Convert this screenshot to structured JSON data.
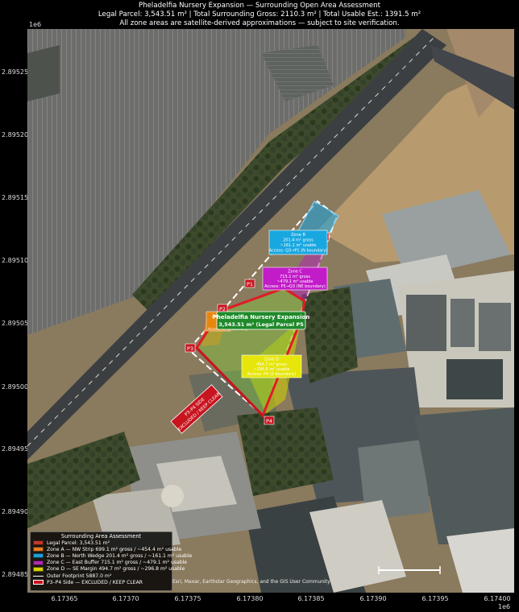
{
  "header": {
    "title": "Pheladelfia Nursery Expansion — Surrounding Open Area Assessment",
    "summary": "Legal Parcel: 3,543.51 m²  |  Total Surrounding Gross: 2110.3 m²  |  Total Usable Est.: 1391.5 m²",
    "note": "All zone areas are satellite-derived approximations — subject to site verification."
  },
  "axes": {
    "y_exponent": "1e6",
    "x_exponent": "1e6",
    "y_ticks": [
      "2.89525",
      "2.89520",
      "2.89515",
      "2.89510",
      "2.89505",
      "2.89500",
      "2.89495",
      "2.89490",
      "2.89485"
    ],
    "x_ticks": [
      "6.17365",
      "6.17370",
      "6.17375",
      "6.17380",
      "6.17385",
      "6.17390",
      "6.17395",
      "6.17400"
    ]
  },
  "points": {
    "p1": "P1",
    "p2": "P2",
    "p3": "P3",
    "p4": "P4",
    "q3": "Q3"
  },
  "zones": {
    "parcel": {
      "line1": "Pheladelfia Nursery Expansion",
      "line2": "3,543.51 m² (Legal Parcel P5"
    },
    "zone_a": {
      "line1": "Zone A",
      "line2": "Access: P2 (W boundary)"
    },
    "zone_b": {
      "line1": "Zone B",
      "line2": "201.4 m² gross",
      "line3": "~161.1 m² usable",
      "line4": "Access: Q3→P1 (N boundary)"
    },
    "zone_c": {
      "line1": "Zone C",
      "line2": "715.1 m² gross",
      "line3": "~479.1 m² usable",
      "line4": "Access: P5→Q3 (NE boundary)"
    },
    "zone_d": {
      "line1": "Zone D",
      "line2": "494.7 m² gross",
      "line3": "~296.8 m² usable",
      "line4": "Access: P4 (S boundary)"
    },
    "excluded": {
      "line1": "P3–P4 SIDE",
      "line2": "EXCLUDED / KEEP CLEAR"
    }
  },
  "legend": {
    "title": "Surrounding Area Assessment",
    "items": [
      {
        "label": "Legal Parcel: 3,543.51 m²",
        "color": "#c0392b"
      },
      {
        "label": "Zone A — NW Strip  699.1 m² gross / ~454.4 m² usable",
        "color": "#e67e22"
      },
      {
        "label": "Zone B — North Wedge  201.4 m² gross / ~161.1 m² usable",
        "color": "#1fa0d8"
      },
      {
        "label": "Zone C — East Buffer  715.1 m² gross / ~479.1 m² usable",
        "color": "#b02ab0"
      },
      {
        "label": "Zone D — SE Margin  494.7 m² gross / ~296.8 m² usable",
        "color": "#d4d400"
      },
      {
        "label": "Outer Footprint  5887.0 m²",
        "color": "#ffffff"
      },
      {
        "label": "P3–P4 Side — EXCLUDED / KEEP CLEAR",
        "color": "#c8141e"
      }
    ]
  },
  "credit": "Esri, Maxar, Earthstar Geographics, and the GIS User Community",
  "colors": {
    "parcel": "#e01b24",
    "zone_a": "#e67e22",
    "zone_b": "#1fa0d8",
    "zone_c": "#b02ab0",
    "zone_d": "#d4d400",
    "excluded": "#c8141e"
  }
}
